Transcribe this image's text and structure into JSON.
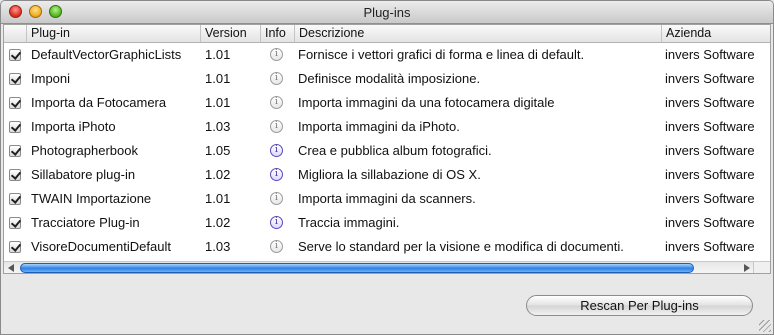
{
  "window": {
    "title": "Plug-ins"
  },
  "table": {
    "columns": {
      "plugin": "Plug-in",
      "version": "Version",
      "info": "Info",
      "description": "Descrizione",
      "company": "Azienda"
    },
    "rows": [
      {
        "enabled": true,
        "name": "DefaultVectorGraphicLists",
        "version": "1.01",
        "info_active": false,
        "description": "Fornisce i vettori grafici di forma e linea di default.",
        "company": "invers Software"
      },
      {
        "enabled": true,
        "name": "Imponi",
        "version": "1.01",
        "info_active": false,
        "description": "Definisce modalità imposizione.",
        "company": "invers Software"
      },
      {
        "enabled": true,
        "name": "Importa da Fotocamera",
        "version": "1.01",
        "info_active": false,
        "description": "Importa immagini da una fotocamera digitale",
        "company": "invers Software"
      },
      {
        "enabled": true,
        "name": "Importa iPhoto",
        "version": "1.03",
        "info_active": false,
        "description": "Importa immagini da iPhoto.",
        "company": "invers Software"
      },
      {
        "enabled": true,
        "name": "Photographerbook",
        "version": "1.05",
        "info_active": true,
        "description": "Crea e pubblica album fotografici.",
        "company": "invers Software"
      },
      {
        "enabled": true,
        "name": "Sillabatore plug-in",
        "version": "1.02",
        "info_active": true,
        "description": "Migliora la sillabazione di OS X.",
        "company": "invers Software"
      },
      {
        "enabled": true,
        "name": "TWAIN Importazione",
        "version": "1.01",
        "info_active": false,
        "description": "Importa immagini da scanners.",
        "company": "invers Software"
      },
      {
        "enabled": true,
        "name": "Tracciatore Plug-in",
        "version": "1.02",
        "info_active": true,
        "description": "Traccia immagini.",
        "company": "invers Software"
      },
      {
        "enabled": true,
        "name": "VisoreDocumentiDefault",
        "version": "1.03",
        "info_active": false,
        "description": "Serve lo standard per la visione e modifica di documenti.",
        "company": "invers Software"
      }
    ],
    "info_glyph": "i"
  },
  "buttons": {
    "rescan": "Rescan Per Plug-ins"
  },
  "icons": {
    "checkbox": "checkmark-icon",
    "info": "info-icon"
  },
  "colors": {
    "scroll_thumb": "#2f80e0",
    "info_active": "#3a2aa0"
  }
}
